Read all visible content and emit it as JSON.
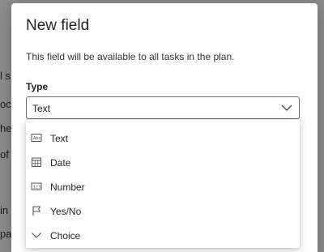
{
  "background": {
    "fragments": [
      "l s",
      "oc",
      "he",
      "of",
      "in",
      "payme"
    ]
  },
  "dialog": {
    "title": "New field",
    "description": "This field will be available to all tasks in the plan.",
    "type_label": "Type",
    "select": {
      "value": "Text",
      "expanded": true
    },
    "options": [
      {
        "label": "Text",
        "icon": "text-field-icon"
      },
      {
        "label": "Date",
        "icon": "calendar-icon"
      },
      {
        "label": "Number",
        "icon": "number-field-icon"
      },
      {
        "label": "Yes/No",
        "icon": "flag-icon"
      },
      {
        "label": "Choice",
        "icon": "chevron-down-icon"
      }
    ]
  }
}
